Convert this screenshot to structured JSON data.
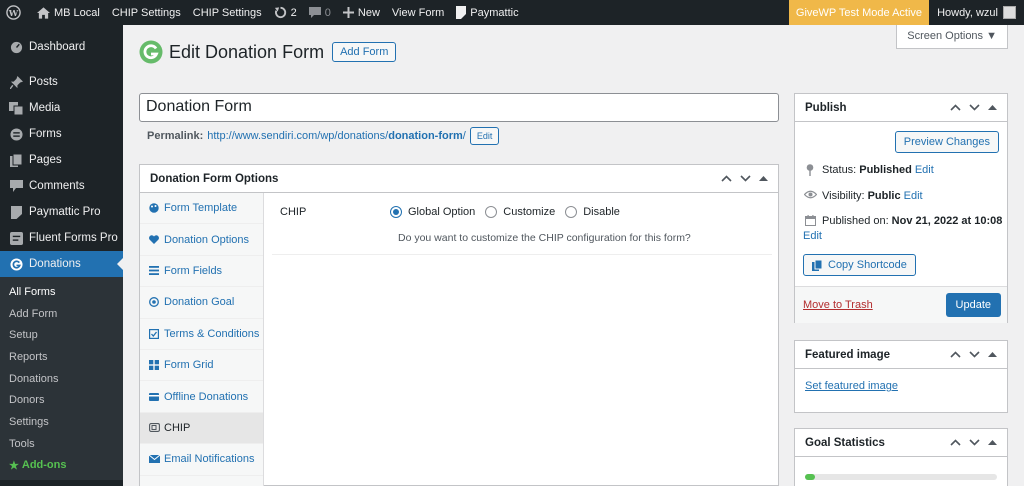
{
  "adminbar": {
    "site_name": "MB Local",
    "chip_settings_1": "CHIP Settings",
    "chip_settings_2": "CHIP Settings",
    "updates_count": "2",
    "comments_count": "0",
    "new_label": "New",
    "view_form": "View Form",
    "paymattic": "Paymattic",
    "test_mode": "GiveWP Test Mode Active",
    "howdy": "Howdy, wzul"
  },
  "sidebar": {
    "items": [
      {
        "label": "Dashboard",
        "icon": "dashboard-icon"
      },
      {
        "label": "Posts",
        "icon": "pin-icon"
      },
      {
        "label": "Media",
        "icon": "media-icon"
      },
      {
        "label": "Forms",
        "icon": "forms-icon"
      },
      {
        "label": "Pages",
        "icon": "pages-icon"
      },
      {
        "label": "Comments",
        "icon": "comment-icon"
      },
      {
        "label": "Paymattic Pro",
        "icon": "paymattic-icon"
      },
      {
        "label": "Fluent Forms Pro",
        "icon": "fluent-icon"
      },
      {
        "label": "Donations",
        "icon": "givewp-icon"
      }
    ],
    "submenu": [
      "All Forms",
      "Add Form",
      "Setup",
      "Reports",
      "Donations",
      "Donors",
      "Settings",
      "Tools",
      "Add-ons"
    ]
  },
  "header": {
    "title": "Edit Donation Form",
    "add_form": "Add Form",
    "screen_options": "Screen Options ▼"
  },
  "post": {
    "title": "Donation Form",
    "permalink_label": "Permalink:",
    "permalink_base": "http://www.sendiri.com/wp/donations/",
    "permalink_slug": "donation-form",
    "permalink_trail": "/",
    "edit_btn": "Edit"
  },
  "options": {
    "title": "Donation Form Options",
    "tabs": [
      {
        "label": "Form Template",
        "icon": "palette-icon"
      },
      {
        "label": "Donation Options",
        "icon": "heart-icon"
      },
      {
        "label": "Form Fields",
        "icon": "list-icon"
      },
      {
        "label": "Donation Goal",
        "icon": "target-icon"
      },
      {
        "label": "Terms & Conditions",
        "icon": "checkbox-icon"
      },
      {
        "label": "Form Grid",
        "icon": "grid-icon"
      },
      {
        "label": "Offline Donations",
        "icon": "offline-icon"
      },
      {
        "label": "CHIP",
        "icon": "chip-icon"
      },
      {
        "label": "Email Notifications",
        "icon": "email-icon"
      }
    ],
    "chip": {
      "label": "CHIP",
      "radios": [
        {
          "label": "Global Option",
          "checked": true
        },
        {
          "label": "Customize",
          "checked": false
        },
        {
          "label": "Disable",
          "checked": false
        }
      ],
      "description": "Do you want to customize the CHIP configuration for this form?"
    }
  },
  "publish": {
    "title": "Publish",
    "preview": "Preview Changes",
    "status_label": "Status:",
    "status_value": "Published",
    "status_edit": "Edit",
    "visibility_label": "Visibility:",
    "visibility_value": "Public",
    "visibility_edit": "Edit",
    "published_label": "Published on:",
    "published_value": "Nov 21, 2022 at 10:08",
    "published_edit": "Edit",
    "copy_shortcode": "Copy Shortcode",
    "trash": "Move to Trash",
    "update": "Update"
  },
  "featured": {
    "title": "Featured image",
    "link": "Set featured image"
  },
  "goal": {
    "title": "Goal Statistics",
    "progress_fraction": 0.05
  },
  "colors": {
    "accent": "#2271b1",
    "admin_dark": "#1d2327",
    "test_mode": "#f0b849",
    "addons_green": "#56c151"
  }
}
